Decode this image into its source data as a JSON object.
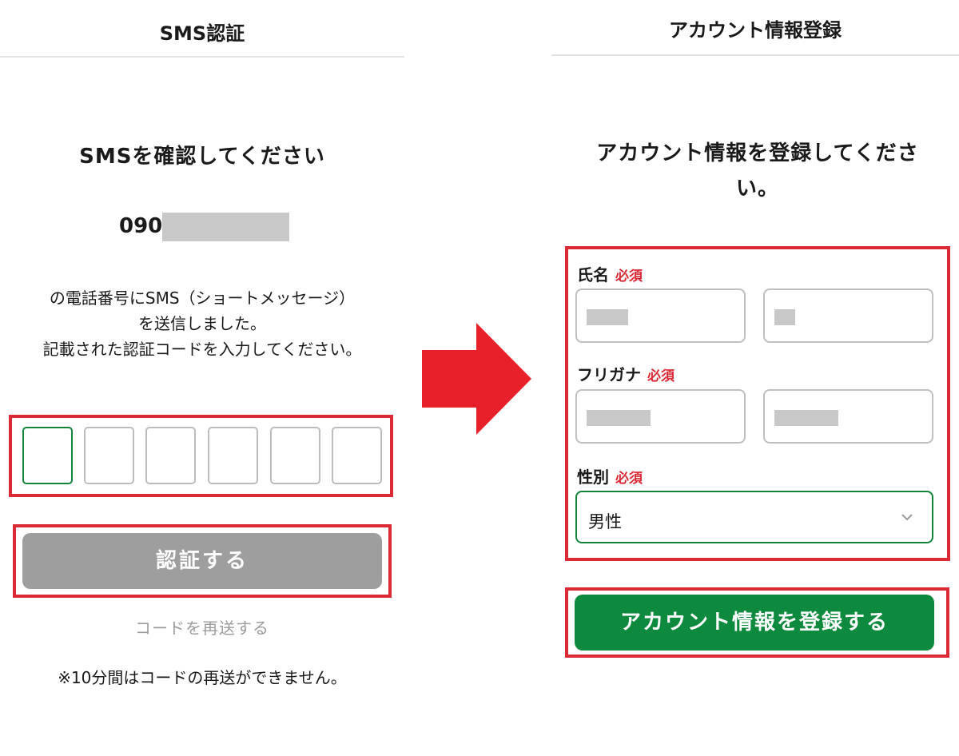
{
  "left": {
    "header_title": "SMS認証",
    "heading": "SMSを確認してください",
    "phone_prefix": "090-",
    "description_lines": [
      "の電話番号にSMS（ショートメッセージ）",
      "を送信しました。",
      "記載された認証コードを入力してください。"
    ],
    "code_digits": [
      "",
      "",
      "",
      "",
      "",
      ""
    ],
    "verify_button": "認証する",
    "resend_link": "コードを再送する",
    "resend_note": "※10分間はコードの再送ができません。"
  },
  "right": {
    "header_title": "アカウント情報登録",
    "heading": "アカウント情報を登録してください。",
    "name_label": "氏名",
    "furigana_label": "フリガナ",
    "gender_label": "性別",
    "required_badge": "必須",
    "gender_selected": "男性",
    "register_button": "アカウント情報を登録する"
  },
  "colors": {
    "highlight": "#d92a36",
    "primary_green": "#0e8a3e",
    "disabled_gray": "#9e9e9e",
    "arrow_red": "#e8202a"
  },
  "icons": {
    "arrow": "right-arrow-icon",
    "chevron": "chevron-down-icon"
  }
}
